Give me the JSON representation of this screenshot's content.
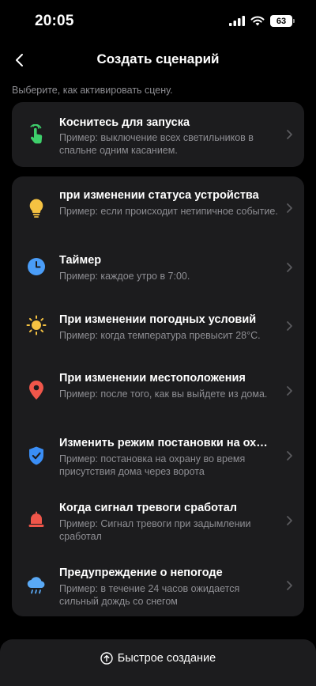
{
  "status_bar": {
    "time": "20:05",
    "battery": "63"
  },
  "nav": {
    "title": "Создать сценарий"
  },
  "subtitle": "Выберите, как активировать сцену.",
  "tap_trigger": {
    "title": "Коснитесь для запуска",
    "description": "Пример: выключение всех светильников в спальне одним касанием.",
    "icon": "tap-hand-icon"
  },
  "triggers": [
    {
      "title": "при изменении статуса устройства",
      "description": "Пример: если происходит нетипичное событие.",
      "icon": "lightbulb-icon"
    },
    {
      "title": "Таймер",
      "description": "Пример: каждое утро в 7:00.",
      "icon": "clock-icon"
    },
    {
      "title": "При изменении погодных условий",
      "description": "Пример: когда температура превысит 28°C.",
      "icon": "sun-icon"
    },
    {
      "title": "При изменении местоположения",
      "description": "Пример: после того, как вы выйдете из дома.",
      "icon": "location-pin-icon"
    },
    {
      "title": "Изменить режим постановки на ох…",
      "description": "Пример: постановка на охрану во время присутствия дома через ворота",
      "icon": "shield-check-icon"
    },
    {
      "title": "Когда сигнал тревоги сработал",
      "description": "Пример: Сигнал тревоги при задымлении сработал",
      "icon": "alarm-bell-icon"
    },
    {
      "title": "Предупреждение о непогоде",
      "description": "Пример: в течение 24 часов ожидается сильный дождь со снегом",
      "icon": "rain-cloud-icon"
    }
  ],
  "bottom": {
    "quick_create_label": "Быстрое создание"
  },
  "colors": {
    "background": "#000000",
    "card": "#1c1c1e",
    "secondary_text": "#8e8e93",
    "tap_green": "#3ecf6b",
    "bulb_yellow": "#f5c242",
    "clock_blue": "#4a9df8",
    "sun_yellow": "#f5c242",
    "pin_red": "#f0564a",
    "shield_blue": "#3a8ef6",
    "bell_red": "#f0564a",
    "cloud_blue": "#5aa9f5"
  }
}
